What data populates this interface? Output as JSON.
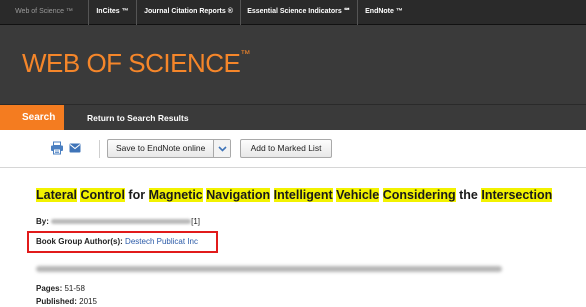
{
  "topnav": {
    "tabs": [
      "Web of Science ™",
      "InCites ™",
      "Journal Citation Reports ®",
      "Essential Science Indicators ℠",
      "EndNote ™"
    ]
  },
  "banner": {
    "brand": "WEB OF SCIENCE",
    "brand_mark": "™"
  },
  "actionbar": {
    "search_tab": "Search",
    "return_link": "Return to Search Results"
  },
  "toolbar": {
    "print_icon": "printer-icon",
    "email_icon": "envelope-icon",
    "save_label": "Save to EndNote online",
    "save_caret_icon": "chevron-down-icon",
    "marked_label": "Add to Marked List"
  },
  "record": {
    "title_words": [
      "Lateral",
      "Control",
      "for",
      "Magnetic",
      "Navigation",
      "Intelligent",
      "Vehicle",
      "Considering",
      "the",
      "Intersection"
    ],
    "by_label": "By:",
    "by_suffix": "[1]",
    "group_label": "Book Group Author(s):",
    "group_value": "Destech Publicat Inc",
    "pages_label": "Pages:",
    "pages_value": "51-58",
    "published_label": "Published:",
    "published_value": "2015"
  },
  "colors": {
    "accent": "#f47c20",
    "highlight": "#f2f200",
    "annotation_box": "#e11b1b",
    "link": "#2a5aa8"
  }
}
